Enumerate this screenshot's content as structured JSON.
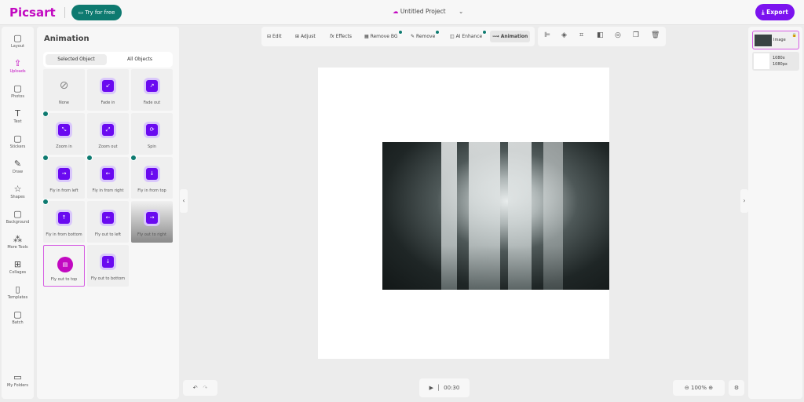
{
  "header": {
    "logo": "Picsart",
    "try_free": "Try for free",
    "project_title": "Untitled Project",
    "export": "Export"
  },
  "rail": [
    {
      "label": "Layout",
      "icon": "layout-icon"
    },
    {
      "label": "Uploads",
      "icon": "upload-icon"
    },
    {
      "label": "Photos",
      "icon": "photos-icon"
    },
    {
      "label": "Text",
      "icon": "text-icon"
    },
    {
      "label": "Stickers",
      "icon": "stickers-icon"
    },
    {
      "label": "Draw",
      "icon": "brush-icon"
    },
    {
      "label": "Shapes",
      "icon": "star-icon"
    },
    {
      "label": "Background",
      "icon": "background-icon"
    },
    {
      "label": "More Tools",
      "icon": "tools-icon"
    },
    {
      "label": "Collages",
      "icon": "collage-icon"
    },
    {
      "label": "Templates",
      "icon": "book-icon"
    },
    {
      "label": "Batch",
      "icon": "batch-icon"
    }
  ],
  "rail_bottom": "My Folders",
  "panel": {
    "title": "Animation",
    "tabs": [
      "Selected Object",
      "All Objects"
    ],
    "items": [
      {
        "label": "None",
        "g": "⊘"
      },
      {
        "label": "Fade in",
        "g": "↙"
      },
      {
        "label": "Fade out",
        "g": "↗"
      },
      {
        "label": "Zoom in",
        "g": "⤡"
      },
      {
        "label": "Zoom out",
        "g": "⤢"
      },
      {
        "label": "Spin",
        "g": "⟳"
      },
      {
        "label": "Fly in from left",
        "g": "→"
      },
      {
        "label": "Fly in from right",
        "g": "←"
      },
      {
        "label": "Fly in from top",
        "g": "↓"
      },
      {
        "label": "Fly in from bottom",
        "g": "↑"
      },
      {
        "label": "Fly out to left",
        "g": "←"
      },
      {
        "label": "Fly out to right",
        "g": "→"
      },
      {
        "label": "Fly out to top",
        "g": "▤"
      },
      {
        "label": "Fly out to bottom",
        "g": "↓"
      }
    ]
  },
  "toolbar": {
    "edit": "Edit",
    "adjust": "Adjust",
    "effects": "Effects",
    "remove_bg": "Remove BG",
    "remove": "Remove",
    "ai_enhance": "AI Enhance",
    "animation": "Animation"
  },
  "layers": {
    "image": "Image",
    "bg_size": "1080x 1080px"
  },
  "playback": {
    "time": "00:30"
  },
  "zoom": {
    "level": "100%"
  }
}
